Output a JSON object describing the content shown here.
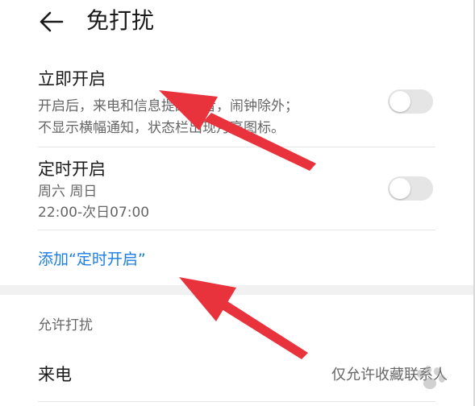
{
  "header": {
    "title": "免打扰"
  },
  "immediate": {
    "title": "立即开启",
    "desc_line1": "开启后，来电和信息提醒静音，闹钟除外；",
    "desc_line2": "不显示横幅通知，状态栏出现月亮图标。",
    "enabled": false
  },
  "scheduled": {
    "title": "定时开启",
    "days": "周六 周日",
    "time_range": "22:00-次日07:00",
    "enabled": false
  },
  "add_schedule_label": "添加“定时开启”",
  "allow_section": {
    "header": "允许打扰",
    "calls_label": "来电",
    "calls_value": "仅允许收藏联系人"
  },
  "colors": {
    "accent": "#1a7ee6",
    "annotation": "#e8323c",
    "toggle_off": "#e5e5e5"
  },
  "icons": {
    "back": "arrow-left-icon"
  }
}
